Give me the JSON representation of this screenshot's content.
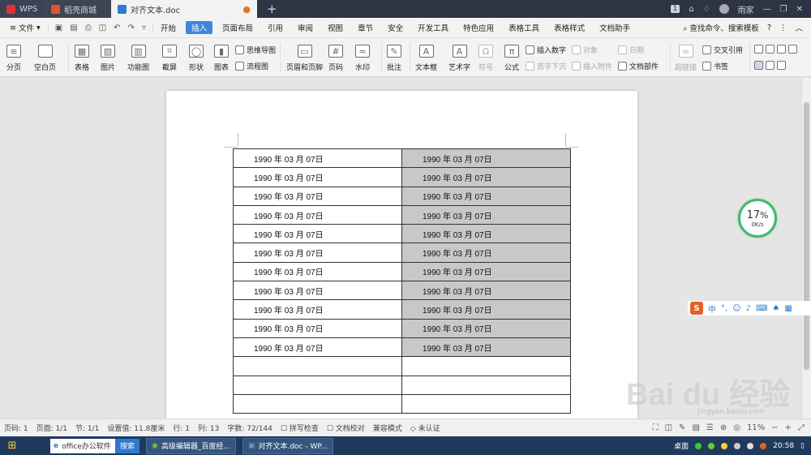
{
  "tabs": [
    {
      "label": "WPS"
    },
    {
      "label": "稻壳商城"
    },
    {
      "label": "对齐文本.doc"
    }
  ],
  "titlebar": {
    "page_num": "1",
    "user": "雨家"
  },
  "menu": {
    "file": "文件",
    "items": [
      "开始",
      "插入",
      "页面布局",
      "引用",
      "审阅",
      "视图",
      "章节",
      "安全",
      "开发工具",
      "特色应用",
      "表格工具",
      "表格样式",
      "文档助手"
    ],
    "search": "查找命令、搜索模板"
  },
  "ribbon": {
    "page_break": "分页",
    "blank_page": "空白页",
    "table": "表格",
    "picture": "图片",
    "func_chart": "功能图",
    "screenshot": "截屏",
    "shape": "形状",
    "chart": "图表",
    "mindmap": "思维导图",
    "flowchart": "流程图",
    "header_footer": "页眉和页脚",
    "page_num": "页码",
    "watermark": "水印",
    "comment": "批注",
    "textbox": "文本框",
    "wordart": "艺术字",
    "symbol": "符号",
    "formula": "公式",
    "insert_number": "插入数字",
    "object": "对象",
    "drop_cap": "首字下沉",
    "date": "日期",
    "attachment": "插入附件",
    "doc_parts": "文档部件",
    "hyperlink": "超链接",
    "cross_ref": "交叉引用",
    "bookmark": "书签"
  },
  "table": {
    "rows": [
      [
        "1990 年 03 月 07日",
        "1990 年 03 月 07日"
      ],
      [
        "1990 年 03 月 07日",
        "1990 年 03 月 07日"
      ],
      [
        "1990 年 03 月 07日",
        "1990 年 03 月 07日"
      ],
      [
        "1990 年 03 月 07日",
        "1990 年 03 月 07日"
      ],
      [
        "1990 年 03 月 07日",
        "1990 年 03 月 07日"
      ],
      [
        "1990 年 03 月 07日",
        "1990 年 03 月 07日"
      ],
      [
        "1990 年 03 月 07日",
        "1990 年 03 月 07日"
      ],
      [
        "1990 年 03 月 07日",
        "1990 年 03 月 07日"
      ],
      [
        "1990 年 03 月 07日",
        "1990 年 03 月 07日"
      ],
      [
        "1990 年 03 月 07日",
        "1990 年 03 月 07日"
      ],
      [
        "1990 年 03 月 07日",
        "1990 年 03 月 07日"
      ],
      [
        "",
        ""
      ],
      [
        "",
        ""
      ],
      [
        "",
        ""
      ]
    ]
  },
  "gauge": {
    "percent": "17",
    "unit": "%",
    "speed": "0K/s"
  },
  "ime": {
    "logo": "S",
    "mode": "中"
  },
  "watermark": {
    "text": "Bai du 经验",
    "url": "jingyan.baidu.com"
  },
  "status": {
    "page": "页码: 1",
    "pages": "页面: 1/1",
    "section": "节: 1/1",
    "setting": "设置值: 11.8厘米",
    "row": "行: 1",
    "col": "列: 13",
    "words": "字数: 72/144",
    "spell": "拼写检查",
    "proof": "文档校对",
    "compat": "兼容模式",
    "cert": "未认证",
    "zoom": "11%"
  },
  "taskbar": {
    "search_text": "office办公软件",
    "search_btn": "搜索",
    "btn1": "高级编辑器_百度经...",
    "btn2": "对齐文本.doc - WP...",
    "desktop": "桌面",
    "time": "20:58"
  },
  "colors": {
    "accent": "#3d86dc",
    "titlebar": "#2d3444",
    "cell_shade": "#c8c8c8",
    "taskbar": "#1f3a5c"
  }
}
